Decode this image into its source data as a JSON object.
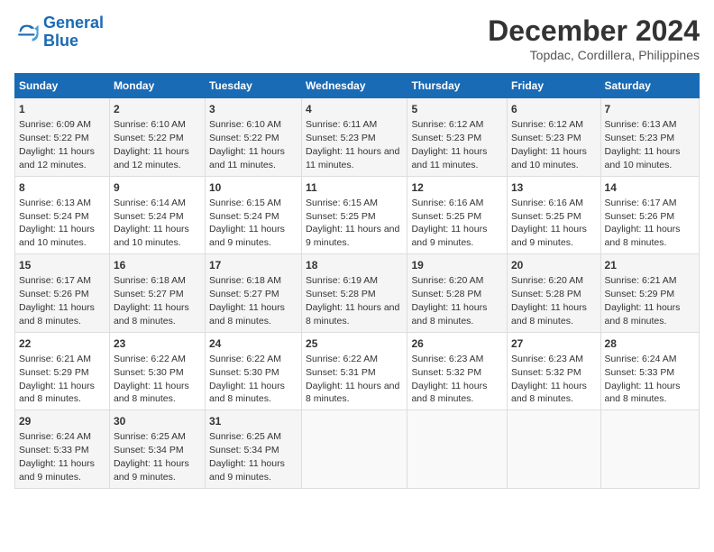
{
  "logo": {
    "line1": "General",
    "line2": "Blue"
  },
  "title": {
    "month_year": "December 2024",
    "location": "Topdac, Cordillera, Philippines"
  },
  "days_of_week": [
    "Sunday",
    "Monday",
    "Tuesday",
    "Wednesday",
    "Thursday",
    "Friday",
    "Saturday"
  ],
  "weeks": [
    [
      {
        "day": "1",
        "sunrise": "6:09 AM",
        "sunset": "5:22 PM",
        "daylight": "11 hours and 12 minutes."
      },
      {
        "day": "2",
        "sunrise": "6:10 AM",
        "sunset": "5:22 PM",
        "daylight": "11 hours and 12 minutes."
      },
      {
        "day": "3",
        "sunrise": "6:10 AM",
        "sunset": "5:22 PM",
        "daylight": "11 hours and 11 minutes."
      },
      {
        "day": "4",
        "sunrise": "6:11 AM",
        "sunset": "5:23 PM",
        "daylight": "11 hours and 11 minutes."
      },
      {
        "day": "5",
        "sunrise": "6:12 AM",
        "sunset": "5:23 PM",
        "daylight": "11 hours and 11 minutes."
      },
      {
        "day": "6",
        "sunrise": "6:12 AM",
        "sunset": "5:23 PM",
        "daylight": "11 hours and 10 minutes."
      },
      {
        "day": "7",
        "sunrise": "6:13 AM",
        "sunset": "5:23 PM",
        "daylight": "11 hours and 10 minutes."
      }
    ],
    [
      {
        "day": "8",
        "sunrise": "6:13 AM",
        "sunset": "5:24 PM",
        "daylight": "11 hours and 10 minutes."
      },
      {
        "day": "9",
        "sunrise": "6:14 AM",
        "sunset": "5:24 PM",
        "daylight": "11 hours and 10 minutes."
      },
      {
        "day": "10",
        "sunrise": "6:15 AM",
        "sunset": "5:24 PM",
        "daylight": "11 hours and 9 minutes."
      },
      {
        "day": "11",
        "sunrise": "6:15 AM",
        "sunset": "5:25 PM",
        "daylight": "11 hours and 9 minutes."
      },
      {
        "day": "12",
        "sunrise": "6:16 AM",
        "sunset": "5:25 PM",
        "daylight": "11 hours and 9 minutes."
      },
      {
        "day": "13",
        "sunrise": "6:16 AM",
        "sunset": "5:25 PM",
        "daylight": "11 hours and 9 minutes."
      },
      {
        "day": "14",
        "sunrise": "6:17 AM",
        "sunset": "5:26 PM",
        "daylight": "11 hours and 8 minutes."
      }
    ],
    [
      {
        "day": "15",
        "sunrise": "6:17 AM",
        "sunset": "5:26 PM",
        "daylight": "11 hours and 8 minutes."
      },
      {
        "day": "16",
        "sunrise": "6:18 AM",
        "sunset": "5:27 PM",
        "daylight": "11 hours and 8 minutes."
      },
      {
        "day": "17",
        "sunrise": "6:18 AM",
        "sunset": "5:27 PM",
        "daylight": "11 hours and 8 minutes."
      },
      {
        "day": "18",
        "sunrise": "6:19 AM",
        "sunset": "5:28 PM",
        "daylight": "11 hours and 8 minutes."
      },
      {
        "day": "19",
        "sunrise": "6:20 AM",
        "sunset": "5:28 PM",
        "daylight": "11 hours and 8 minutes."
      },
      {
        "day": "20",
        "sunrise": "6:20 AM",
        "sunset": "5:28 PM",
        "daylight": "11 hours and 8 minutes."
      },
      {
        "day": "21",
        "sunrise": "6:21 AM",
        "sunset": "5:29 PM",
        "daylight": "11 hours and 8 minutes."
      }
    ],
    [
      {
        "day": "22",
        "sunrise": "6:21 AM",
        "sunset": "5:29 PM",
        "daylight": "11 hours and 8 minutes."
      },
      {
        "day": "23",
        "sunrise": "6:22 AM",
        "sunset": "5:30 PM",
        "daylight": "11 hours and 8 minutes."
      },
      {
        "day": "24",
        "sunrise": "6:22 AM",
        "sunset": "5:30 PM",
        "daylight": "11 hours and 8 minutes."
      },
      {
        "day": "25",
        "sunrise": "6:22 AM",
        "sunset": "5:31 PM",
        "daylight": "11 hours and 8 minutes."
      },
      {
        "day": "26",
        "sunrise": "6:23 AM",
        "sunset": "5:32 PM",
        "daylight": "11 hours and 8 minutes."
      },
      {
        "day": "27",
        "sunrise": "6:23 AM",
        "sunset": "5:32 PM",
        "daylight": "11 hours and 8 minutes."
      },
      {
        "day": "28",
        "sunrise": "6:24 AM",
        "sunset": "5:33 PM",
        "daylight": "11 hours and 8 minutes."
      }
    ],
    [
      {
        "day": "29",
        "sunrise": "6:24 AM",
        "sunset": "5:33 PM",
        "daylight": "11 hours and 9 minutes."
      },
      {
        "day": "30",
        "sunrise": "6:25 AM",
        "sunset": "5:34 PM",
        "daylight": "11 hours and 9 minutes."
      },
      {
        "day": "31",
        "sunrise": "6:25 AM",
        "sunset": "5:34 PM",
        "daylight": "11 hours and 9 minutes."
      },
      null,
      null,
      null,
      null
    ]
  ]
}
